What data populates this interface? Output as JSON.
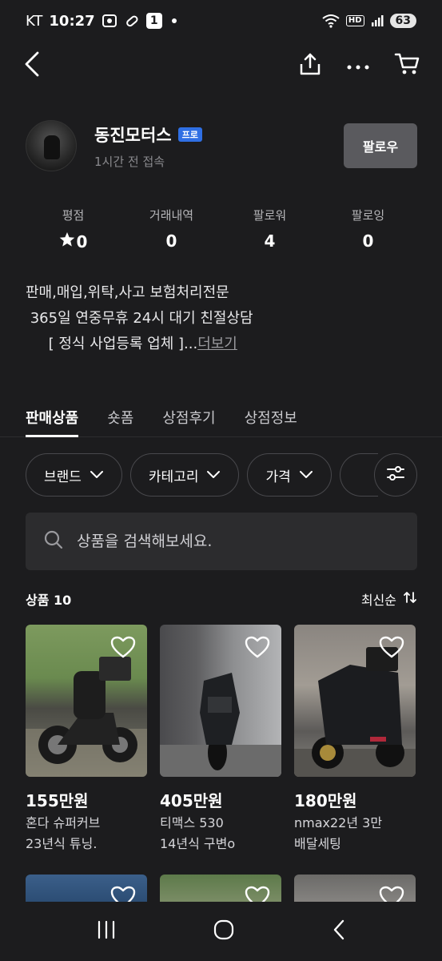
{
  "status_bar": {
    "carrier": "KT",
    "time": "10:27",
    "notification_count": "1",
    "hd_label": "HD",
    "battery": "63"
  },
  "profile": {
    "shop_name": "동진모터스",
    "badge": "프로",
    "last_seen": "1시간 전 접속",
    "follow_label": "팔로우"
  },
  "stats": [
    {
      "label": "평점",
      "value": "0"
    },
    {
      "label": "거래내역",
      "value": "0"
    },
    {
      "label": "팔로워",
      "value": "4"
    },
    {
      "label": "팔로잉",
      "value": "0"
    }
  ],
  "description": {
    "line1": "판매,매입,위탁,사고 보험처리전문",
    "line2": " 365일 연중무휴 24시 대기 친절상담",
    "line3": "     [ 정식 사업등록 업체 ]...",
    "more": "더보기"
  },
  "tabs": [
    {
      "label": "판매상품",
      "active": true
    },
    {
      "label": "숏폼"
    },
    {
      "label": "상점후기"
    },
    {
      "label": "상점정보"
    }
  ],
  "filters": [
    {
      "label": "브랜드"
    },
    {
      "label": "카테고리"
    },
    {
      "label": "가격"
    }
  ],
  "search": {
    "placeholder": "상품을 검색해보세요."
  },
  "list_header": {
    "count_label": "상품 10",
    "sort_label": "최신순"
  },
  "products": [
    {
      "price": "155만원",
      "line1": "혼다 슈퍼커브",
      "line2": "23년식 튜닝."
    },
    {
      "price": "405만원",
      "line1": "티맥스 530",
      "line2": "14년식 구변o"
    },
    {
      "price": "180만원",
      "line1": "nmax22년 3만",
      "line2": "배달세팅"
    }
  ],
  "icons": {
    "back": "back-arrow-icon",
    "share": "share-icon",
    "more": "more-dots-icon",
    "cart": "cart-icon",
    "star": "star-icon",
    "heart": "heart-icon",
    "search": "search-icon",
    "filter": "filter-sliders-icon",
    "sort": "sort-arrows-icon"
  }
}
